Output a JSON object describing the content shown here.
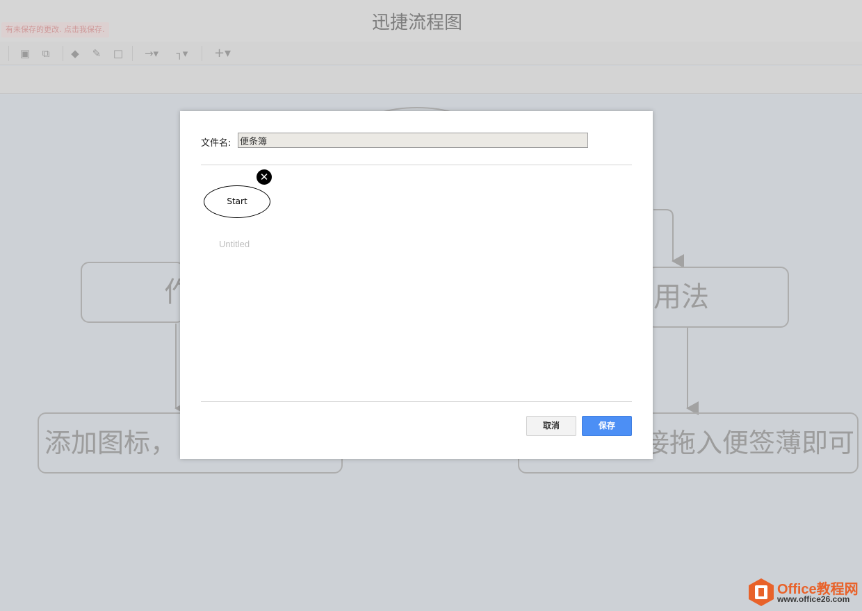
{
  "app": {
    "title": "迅捷流程图",
    "unsaved_notice": "有未保存的更改. 点击我保存."
  },
  "toolbar": {
    "icons": [
      "to-front-icon",
      "to-back-icon",
      "fill-color-icon",
      "line-color-icon",
      "shadow-icon",
      "connector-style-icon",
      "waypoint-style-icon",
      "insert-icon"
    ]
  },
  "canvas": {
    "shapes": {
      "left_mid": "作",
      "right_mid": "用法",
      "left_bottom": "添加图标，",
      "right_bottom": "接拖入便签薄即可"
    }
  },
  "dialog": {
    "filename_label": "文件名:",
    "filename_value": "便条簿",
    "shape_label": "Start",
    "remove_icon": "close-circle-icon",
    "untitled_label": "Untitled",
    "cancel_label": "取消",
    "save_label": "保存"
  },
  "watermark": {
    "brand": "Office教程网",
    "url": "www.office26.com",
    "icon": "office-logo-icon"
  },
  "colors": {
    "primary_button": "#4c8ff5",
    "overlay": "#cfd3d8",
    "watermark": "#e8622a"
  }
}
